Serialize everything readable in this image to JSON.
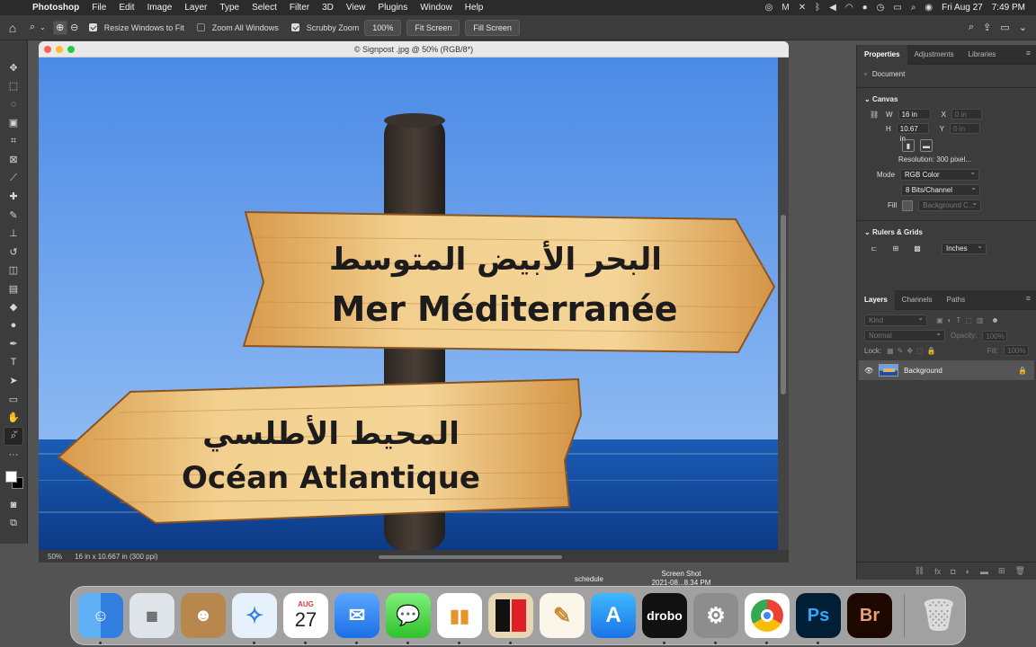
{
  "menubar": {
    "app": "Photoshop",
    "items": [
      "File",
      "Edit",
      "Image",
      "Layer",
      "Type",
      "Select",
      "Filter",
      "3D",
      "View",
      "Plugins",
      "Window",
      "Help"
    ],
    "date": "Fri Aug 27",
    "time": "7:49 PM"
  },
  "options": {
    "resize_windows": "Resize Windows to Fit",
    "zoom_all": "Zoom All Windows",
    "scrubby": "Scrubby Zoom",
    "zoom_value": "100%",
    "fit_screen": "Fit Screen",
    "fill_screen": "Fill Screen"
  },
  "document": {
    "title": "© Signpost .jpg @ 50% (RGB/8*)",
    "zoom": "50%",
    "info": "16 in x 10.667 in (300 ppi)",
    "sign_top_arabic": "البحر الأبيض المتوسط",
    "sign_top_french": "Mer Méditerranée",
    "sign_bottom_arabic": "المحيط الأطلسي",
    "sign_bottom_french": "Océan Atlantique"
  },
  "properties": {
    "tabs": [
      "Properties",
      "Adjustments",
      "Libraries"
    ],
    "doc_label": "Document",
    "canvas_label": "Canvas",
    "w_label": "W",
    "w_value": "16 in",
    "h_label": "H",
    "h_value": "10.67 in",
    "x_label": "X",
    "x_value": "0 in",
    "y_label": "Y",
    "y_value": "0 in",
    "resolution": "Resolution: 300 pixel...",
    "mode_label": "Mode",
    "mode_value": "RGB Color",
    "bits_value": "8 Bits/Channel",
    "fill_label": "Fill",
    "fill_value": "Background C...",
    "rulers_label": "Rulers & Grids",
    "units_value": "Inches"
  },
  "layers": {
    "tabs": [
      "Layers",
      "Channels",
      "Paths"
    ],
    "kind_label": "Kind",
    "blend_value": "Normal",
    "opacity_label": "Opacity:",
    "opacity_value": "100%",
    "lock_label": "Lock:",
    "fill_label": "Fill:",
    "fill_value": "100%",
    "layer_name": "Background"
  },
  "desktop": {
    "label1": "schedule",
    "label2a": "Screen Shot",
    "label2b": "2021-08...8.34 PM"
  },
  "dock": {
    "calendar_month": "AUG",
    "calendar_day": "27",
    "drobo": "drobo",
    "ps": "Ps",
    "br": "Br"
  }
}
